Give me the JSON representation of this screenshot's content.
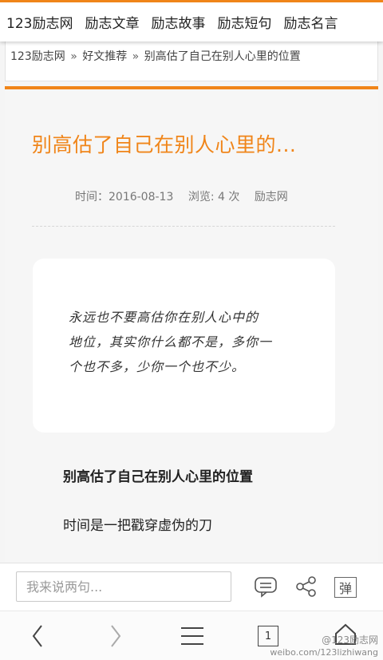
{
  "topnav": {
    "items": [
      "123励志网",
      "励志文章",
      "励志故事",
      "励志短句",
      "励志名言"
    ]
  },
  "breadcrumb": {
    "items": [
      "123励志网",
      "好文推荐",
      "别高估了自己在别人心里的位置"
    ],
    "separator": "»"
  },
  "article": {
    "title": "别高估了自己在别人心里的...",
    "meta": {
      "time": "时间：2016-08-13",
      "views": "浏览: 4 次",
      "source": "励志网"
    },
    "quote_lines": [
      "永远也不要高估你在别人心中的",
      "地位，其实你什么都不是，多你一",
      "个也不多，少你一个也不少。"
    ],
    "subheading": "别高估了自己在别人心里的位置",
    "paragraph": "时间是一把戳穿虚伪的刀"
  },
  "comment": {
    "placeholder": "我来说两句...",
    "danmu_label": "弹"
  },
  "bottomnav": {
    "tab_count": "1"
  },
  "watermark": {
    "line1": "@123励志网",
    "line2": "weibo.com/123lizhiwang"
  },
  "colors": {
    "accent": "#f08519"
  }
}
